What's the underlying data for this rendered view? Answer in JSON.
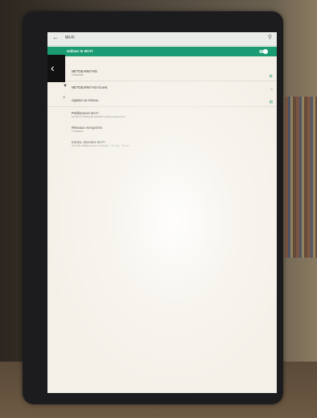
{
  "app_bar": {
    "nav_icon": "back-arrow-icon",
    "title": "Wi-Fi",
    "search_icon": "search-icon"
  },
  "toggle": {
    "label": "Utiliser le Wi-Fi",
    "state": "on"
  },
  "networks": [
    {
      "name": "NETGEAR67-5G",
      "status": "Connecté"
    },
    {
      "name": "NETGEAR67-5G-Guest",
      "status": ""
    }
  ],
  "add_network": {
    "label": "Ajouter un réseau"
  },
  "settings": [
    {
      "title": "Préférences Wi-Fi",
      "subtitle": "Le Wi-Fi n'est pas réactivé automatiquement"
    },
    {
      "title": "Réseaux enregistrés",
      "subtitle": "2 réseaux"
    },
    {
      "title": "Conso. données Wi-Fi",
      "subtitle": "124 Mo utilisés pour la période : 29 mai - 26 juin"
    }
  ],
  "colors": {
    "accent": "#1a9b73",
    "screen_bg": "#f4f0e8",
    "bezel": "#1c1c1e"
  }
}
